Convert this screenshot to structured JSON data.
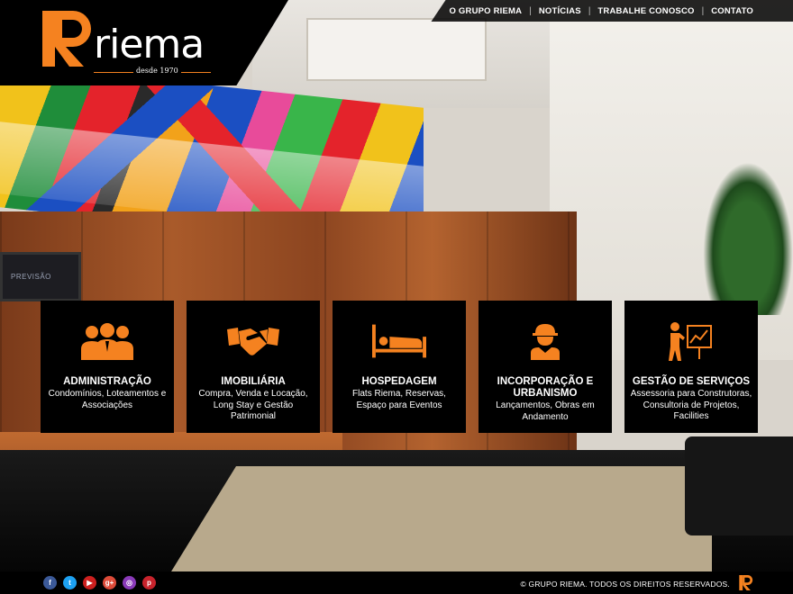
{
  "brand": {
    "name": "riema",
    "since": "desde 1970",
    "accent": "#f58220"
  },
  "nav": {
    "items": [
      "O GRUPO RIEMA",
      "NOTÍCIAS",
      "TRABALHE CONOSCO",
      "CONTATO"
    ],
    "separator": "|"
  },
  "background": {
    "monitor_text": "PREVISÃO"
  },
  "cards": [
    {
      "icon": "people-icon",
      "title": "ADMINISTRAÇÃO",
      "desc": "Condomínios, Loteamentos e Associações"
    },
    {
      "icon": "handshake-icon",
      "title": "IMOBILIÁRIA",
      "desc": "Compra, Venda e Locação, Long Stay e Gestão Patrimonial"
    },
    {
      "icon": "bed-icon",
      "title": "HOSPEDAGEM",
      "desc": "Flats Riema, Reservas, Espaço para Eventos"
    },
    {
      "icon": "construction-worker-icon",
      "title": "INCORPORAÇÃO E URBANISMO",
      "desc": "Lançamentos, Obras em Andamento"
    },
    {
      "icon": "presentation-icon",
      "title": "GESTÃO DE SERVIÇOS",
      "desc": "Assessoria para Construtoras, Consultoria de Projetos, Facilities"
    }
  ],
  "footer": {
    "socials": [
      {
        "name": "facebook-icon",
        "glyph": "f",
        "color": "#3b5998"
      },
      {
        "name": "twitter-icon",
        "glyph": "t",
        "color": "#1da1f2"
      },
      {
        "name": "youtube-icon",
        "glyph": "▶",
        "color": "#cd201f"
      },
      {
        "name": "googleplus-icon",
        "glyph": "g+",
        "color": "#dd4b39"
      },
      {
        "name": "instagram-icon",
        "glyph": "◎",
        "color": "#8a3ab9"
      },
      {
        "name": "pinterest-icon",
        "glyph": "p",
        "color": "#c8232c"
      }
    ],
    "copyright": "© GRUPO RIEMA. TODOS OS DIREITOS RESERVADOS."
  }
}
